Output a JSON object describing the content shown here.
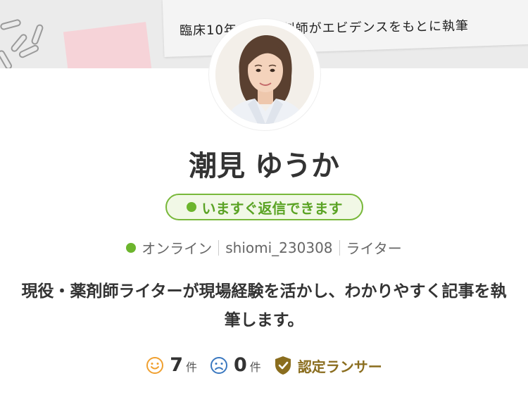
{
  "banner": {
    "text": "臨床10年 現役薬剤師がエビデンスをもとに執筆"
  },
  "profile": {
    "name": "潮見 ゆうか",
    "reply_status": "いますぐ返信できます",
    "online_status": "オンライン",
    "username": "shiomi_230308",
    "role": "ライター",
    "bio": "現役・薬剤師ライターが現場経験を活かし、わかりやすく記事を執筆します。"
  },
  "stats": {
    "good_count": "7",
    "good_unit": "件",
    "bad_count": "0",
    "bad_unit": "件",
    "certified_label": "認定ランサー"
  },
  "colors": {
    "online_green": "#6cb52d",
    "reply_border": "#78b83a",
    "good_orange": "#f0a030",
    "bad_blue": "#3a78c0",
    "certified_gold": "#8a6d1e"
  },
  "icons": [
    "smile-icon",
    "frown-icon",
    "shield-check-icon",
    "paperclip-icon"
  ]
}
